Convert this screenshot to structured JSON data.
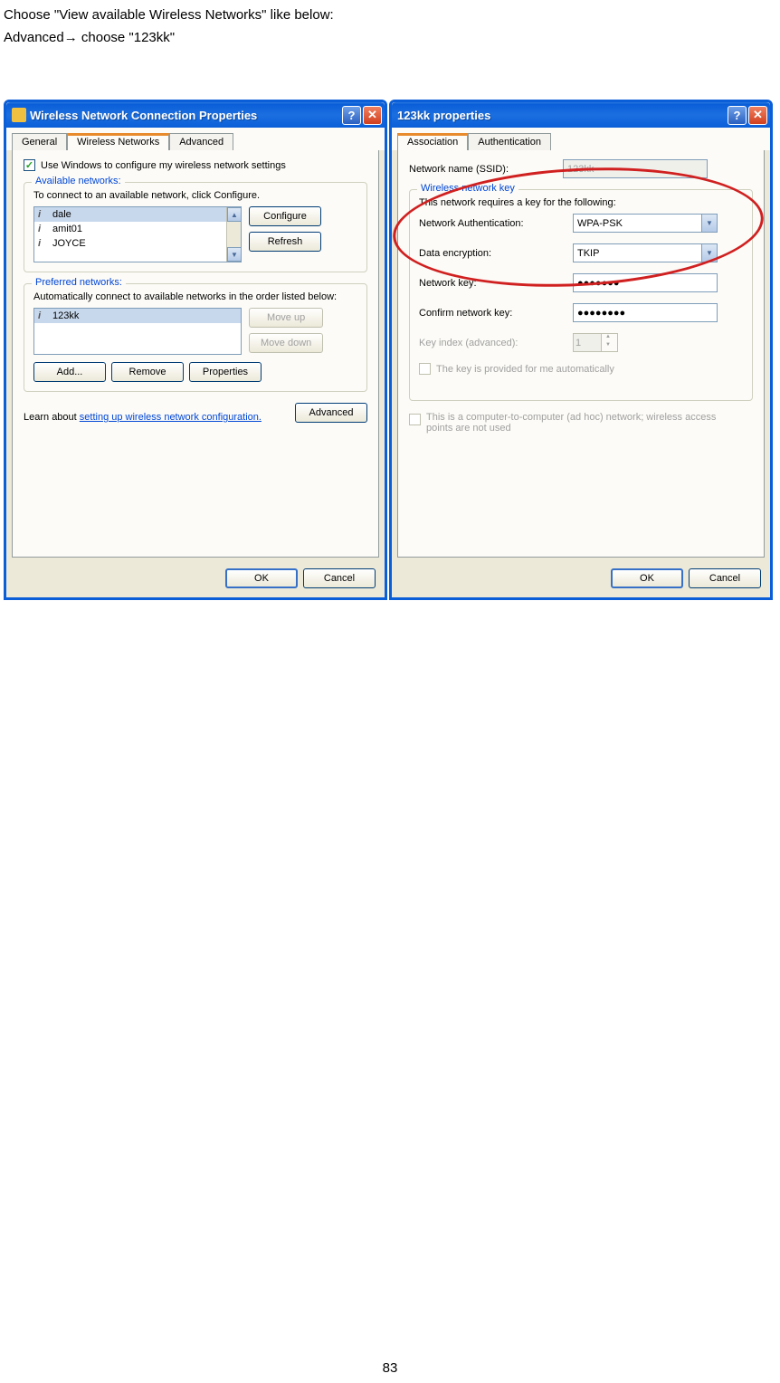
{
  "doc": {
    "line1": "Choose \"View available Wireless Networks\" like below:",
    "line2_pre": "Advanced",
    "line2_arrow": "→",
    "line2_post": " choose \"123kk\"",
    "page_number": "83"
  },
  "window1": {
    "title": "Wireless Network Connection Properties",
    "tabs": [
      "General",
      "Wireless Networks",
      "Advanced"
    ],
    "active_tab": 1,
    "use_windows_label": "Use Windows to configure my wireless network settings",
    "available": {
      "title": "Available networks:",
      "text": "To connect to an available network, click Configure.",
      "items": [
        "dale",
        "amit01",
        "JOYCE"
      ],
      "configure": "Configure",
      "refresh": "Refresh"
    },
    "preferred": {
      "title": "Preferred networks:",
      "text": "Automatically connect to available networks in the order listed below:",
      "items": [
        "123kk"
      ],
      "move_up": "Move up",
      "move_down": "Move down",
      "add": "Add...",
      "remove": "Remove",
      "properties": "Properties"
    },
    "learn_pre": "Learn about ",
    "learn_link": "setting up wireless network configuration.",
    "advanced": "Advanced",
    "ok": "OK",
    "cancel": "Cancel"
  },
  "window2": {
    "title": "123kk properties",
    "tabs": [
      "Association",
      "Authentication"
    ],
    "active_tab": 0,
    "ssid_label": "Network name (SSID):",
    "ssid_value": "123kk",
    "key_group": {
      "title": "Wireless network key",
      "text": "This network requires a key for the following:",
      "auth_label": "Network Authentication:",
      "auth_value": "WPA-PSK",
      "enc_label": "Data encryption:",
      "enc_value": "TKIP",
      "netkey_label": "Network key:",
      "netkey_value": "●●●●●●●",
      "confirm_label": "Confirm network key:",
      "confirm_value": "●●●●●●●●",
      "index_label": "Key index (advanced):",
      "index_value": "1",
      "auto_label": "The key is provided for me automatically"
    },
    "adhoc_label": "This is a computer-to-computer (ad hoc) network; wireless access points are not used",
    "ok": "OK",
    "cancel": "Cancel"
  }
}
